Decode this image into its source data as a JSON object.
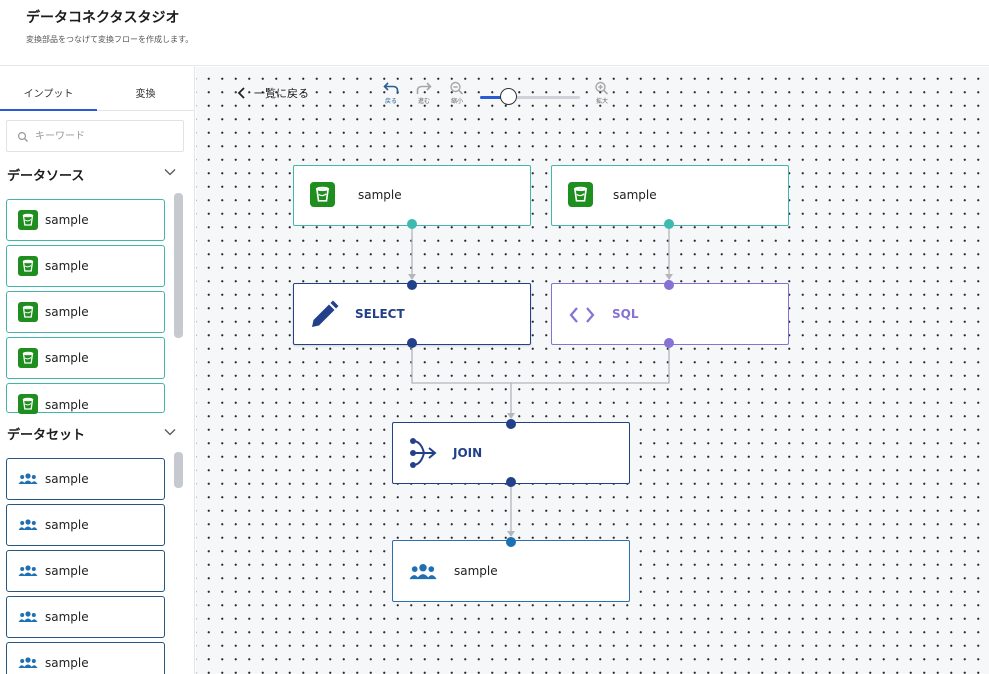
{
  "app": {
    "title": "データコネクタスタジオ",
    "subtitle": "変換部品をつなげて変換フローを作成します。"
  },
  "sidebar": {
    "tabs": [
      {
        "label": "インプット",
        "active": true
      },
      {
        "label": "変換",
        "active": false
      }
    ],
    "search": {
      "placeholder": "キーワード",
      "value": ""
    },
    "sections": [
      {
        "label": "データソース",
        "expanded": true,
        "items": [
          {
            "label": "sample",
            "icon": "bucket-icon"
          },
          {
            "label": "sample",
            "icon": "bucket-icon"
          },
          {
            "label": "sample",
            "icon": "bucket-icon"
          },
          {
            "label": "sample",
            "icon": "bucket-icon"
          },
          {
            "label": "sample",
            "icon": "bucket-icon"
          }
        ]
      },
      {
        "label": "データセット",
        "expanded": true,
        "items": [
          {
            "label": "sample",
            "icon": "users-icon"
          },
          {
            "label": "sample",
            "icon": "users-icon"
          },
          {
            "label": "sample",
            "icon": "users-icon"
          },
          {
            "label": "sample",
            "icon": "users-icon"
          },
          {
            "label": "sample",
            "icon": "users-icon"
          }
        ]
      }
    ]
  },
  "toolbar": {
    "back_label": "一覧に戻る",
    "undo_label": "戻る",
    "redo_label": "進む",
    "zoom_out_label": "縮小",
    "zoom_in_label": "拡大",
    "zoom_level": 0.28
  },
  "flow": {
    "nodes": [
      {
        "id": "source-1",
        "label": "sample",
        "type": "source"
      },
      {
        "id": "source-2",
        "label": "sample",
        "type": "source"
      },
      {
        "id": "select",
        "label": "SELECT",
        "type": "transform"
      },
      {
        "id": "sql",
        "label": "SQL",
        "type": "transform"
      },
      {
        "id": "join",
        "label": "JOIN",
        "type": "transform"
      },
      {
        "id": "output",
        "label": "sample",
        "type": "dataset"
      }
    ],
    "edges": [
      {
        "from": "source-1",
        "to": "select"
      },
      {
        "from": "source-2",
        "to": "sql"
      },
      {
        "from": "select",
        "to": "join"
      },
      {
        "from": "sql",
        "to": "join"
      },
      {
        "from": "join",
        "to": "output"
      }
    ]
  },
  "colors": {
    "source_border": "#42b7ad",
    "source_icon": "#1e8e1e",
    "select_border": "#22418a",
    "sql_color": "#8671d5",
    "dataset_border": "#27567f",
    "dataset_icon": "#1f6fb3",
    "accent": "#2a5ad4"
  }
}
